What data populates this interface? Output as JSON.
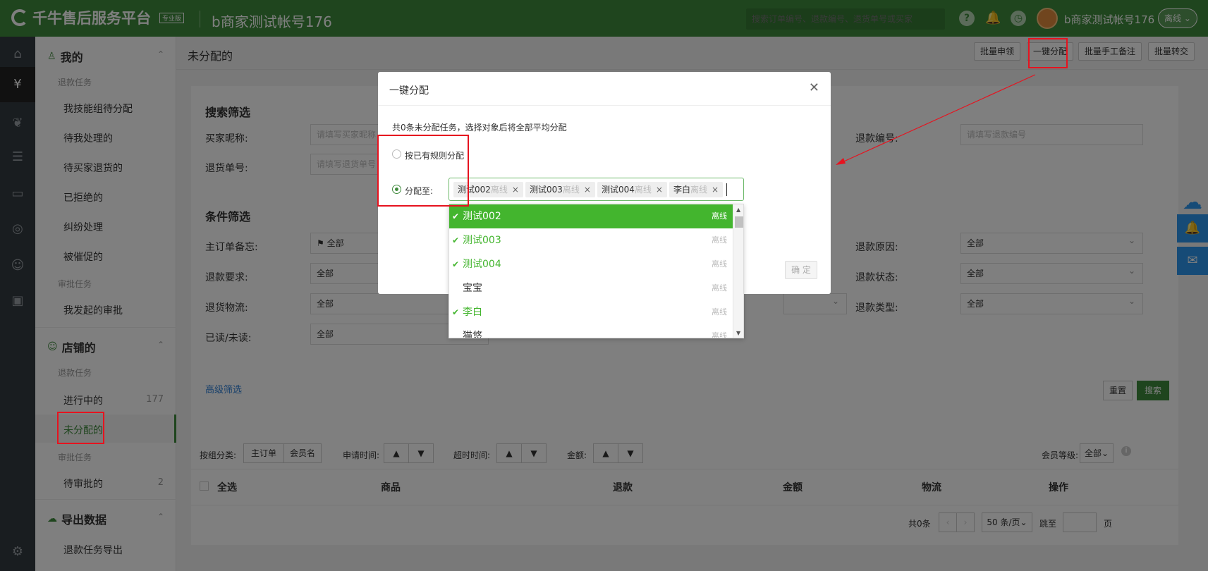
{
  "header": {
    "brand": "千牛售后服务平台",
    "edition": "专业版",
    "account": "b商家测试帐号176",
    "search_placeholder": "搜索订单编号、退款编号、退货单号或买家",
    "user": "b商家测试帐号176",
    "status": "离线"
  },
  "sidebar": {
    "my": "我的",
    "refund_tasks": "退款任务",
    "my_items": [
      "我技能组待分配",
      "待我处理的",
      "待买家退货的",
      "已拒绝的",
      "纠纷处理",
      "被催促的"
    ],
    "review_tasks": "审批任务",
    "my_review": "我发起的审批",
    "shop": "店铺的",
    "shop_refund_tasks": "退款任务",
    "in_progress": "进行中的",
    "in_progress_count": "177",
    "unassigned": "未分配的",
    "shop_review_tasks": "审批任务",
    "pending_review": "待审批的",
    "pending_review_count": "2",
    "export": "导出数据",
    "export_item": "退款任务导出"
  },
  "page": {
    "title": "未分配的",
    "buttons": [
      "批量申领",
      "一键分配",
      "批量手工备注",
      "批量转交"
    ]
  },
  "search": {
    "title": "搜索筛选",
    "buyer_label": "买家昵称:",
    "buyer_ph": "请填写买家昵称",
    "return_label": "退货单号:",
    "return_ph": "请填写退货单号",
    "refund_no_label": "退款编号:",
    "refund_no_ph": "请填写退款编号"
  },
  "cond": {
    "title": "条件筛选",
    "memo_label": "主订单备忘:",
    "memo_val": "全部",
    "req_label": "退款要求:",
    "req_val": "全部",
    "logi_label": "退货物流:",
    "logi_val": "全部",
    "read_label": "已读/未读:",
    "read_val": "全部",
    "reason_label": "退款原因:",
    "reason_val": "全部",
    "status_label": "退款状态:",
    "status_val": "全部",
    "type_label": "退款类型:",
    "type_val": "全部",
    "advanced": "高级筛选",
    "reset": "重置",
    "search": "搜索"
  },
  "sortbar": {
    "group": "按组分类:",
    "main_order": "主订单",
    "member": "会员名",
    "apply_time": "申请时间:",
    "timeout": "超时时间:",
    "amount": "金额:",
    "level": "会员等级:",
    "level_val": "全部"
  },
  "table": {
    "cols": [
      "全选",
      "商品",
      "退款",
      "金额",
      "物流",
      "操作"
    ]
  },
  "pager": {
    "total": "共0条",
    "per_page": "50 条/页",
    "jump": "跳至",
    "page_unit": "页"
  },
  "dialog": {
    "title": "一键分配",
    "hint": "共0条未分配任务，选择对象后将全部平均分配",
    "opt1": "按已有规则分配",
    "opt2": "分配至:",
    "ok": "确 定",
    "tags": [
      {
        "name": "测试002",
        "status": "离线"
      },
      {
        "name": "测试003",
        "status": "离线"
      },
      {
        "name": "测试004",
        "status": "离线"
      },
      {
        "name": "李白",
        "status": "离线"
      }
    ]
  },
  "dropdown": [
    {
      "name": "测试002",
      "status": "离线"
    },
    {
      "name": "测试003",
      "status": "离线"
    },
    {
      "name": "测试004",
      "status": "离线"
    },
    {
      "name": "宝宝",
      "status": "离线"
    },
    {
      "name": "李白",
      "status": "离线"
    },
    {
      "name": "猫悠",
      "status": "离线"
    }
  ],
  "colors": {
    "brand": "#3f8a3c",
    "selected": "#43b52e",
    "annotation": "#e6131f"
  }
}
